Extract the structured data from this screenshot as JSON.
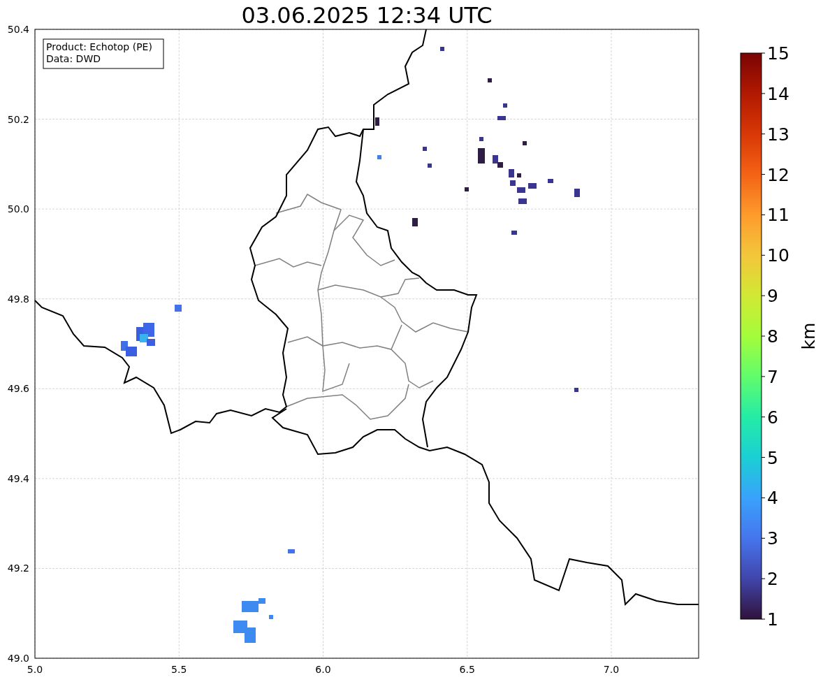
{
  "title": "03.06.2025 12:34 UTC",
  "legend": [
    "Product: Echotop (PE)",
    "Data: DWD"
  ],
  "map": {
    "x_ticks": [
      "5.0",
      "5.5",
      "6.0",
      "6.5",
      "7.0"
    ],
    "y_ticks": [
      "50.4",
      "50.2",
      "50.0",
      "49.8",
      "49.6",
      "49.4",
      "49.2",
      "49.0"
    ]
  },
  "colorbar": {
    "label": "km",
    "ticks": [
      "15",
      "14",
      "13",
      "12",
      "11",
      "10",
      "9",
      "8",
      "7",
      "6",
      "5",
      "4",
      "3",
      "2",
      "1"
    ]
  }
}
